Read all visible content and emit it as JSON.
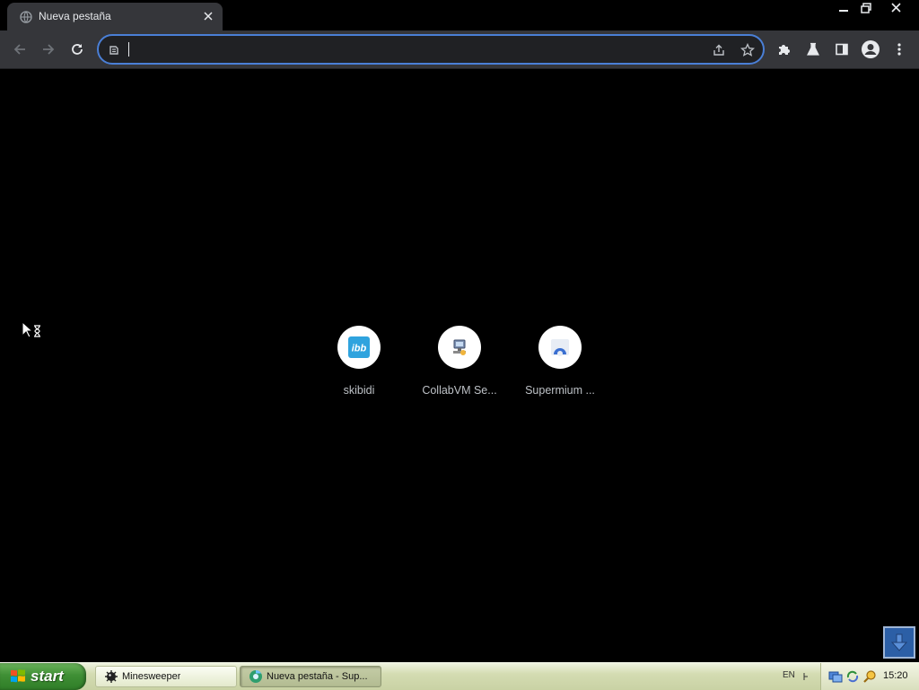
{
  "browser": {
    "tab": {
      "title": "Nueva pestaña",
      "favicon": "globe-icon",
      "close": "close-icon"
    },
    "window_controls": [
      "minimize-icon",
      "restore-icon",
      "close-icon"
    ],
    "toolbar": {
      "back": "back-arrow-icon",
      "forward": "forward-arrow-icon",
      "reload": "reload-icon",
      "omnibox": {
        "value": "",
        "page_icon": "page-info-icon"
      },
      "share": "share-icon",
      "bookmark": "star-icon",
      "extensions": "puzzle-icon",
      "labs": "flask-icon",
      "side_panel": "side-panel-icon",
      "profile": "profile-icon",
      "menu": "kebab-menu-icon"
    }
  },
  "new_tab": {
    "shortcuts": [
      {
        "label": "skibidi",
        "icon": "ibb-icon",
        "icon_text": "ibb",
        "color": "#2fa3de"
      },
      {
        "label": "CollabVM Se...",
        "icon": "collabvm-icon"
      },
      {
        "label": "Supermium ...",
        "icon": "supermium-icon"
      }
    ]
  },
  "taskbar": {
    "start_label": "start",
    "tasks": [
      {
        "label": "Minesweeper",
        "icon": "minesweeper-icon",
        "active": false
      },
      {
        "label": "Nueva pestaña - Sup...",
        "icon": "supermium-icon",
        "active": true
      }
    ],
    "language": "EN",
    "tray_icons": [
      "network-icon",
      "sync-icon",
      "search-icon"
    ],
    "clock": "15:20"
  },
  "colors": {
    "tab_bg": "#35363a",
    "omnibox_border": "#4a7fd6",
    "content_bg": "#000000",
    "taskbar_start": "#3f8f35"
  }
}
